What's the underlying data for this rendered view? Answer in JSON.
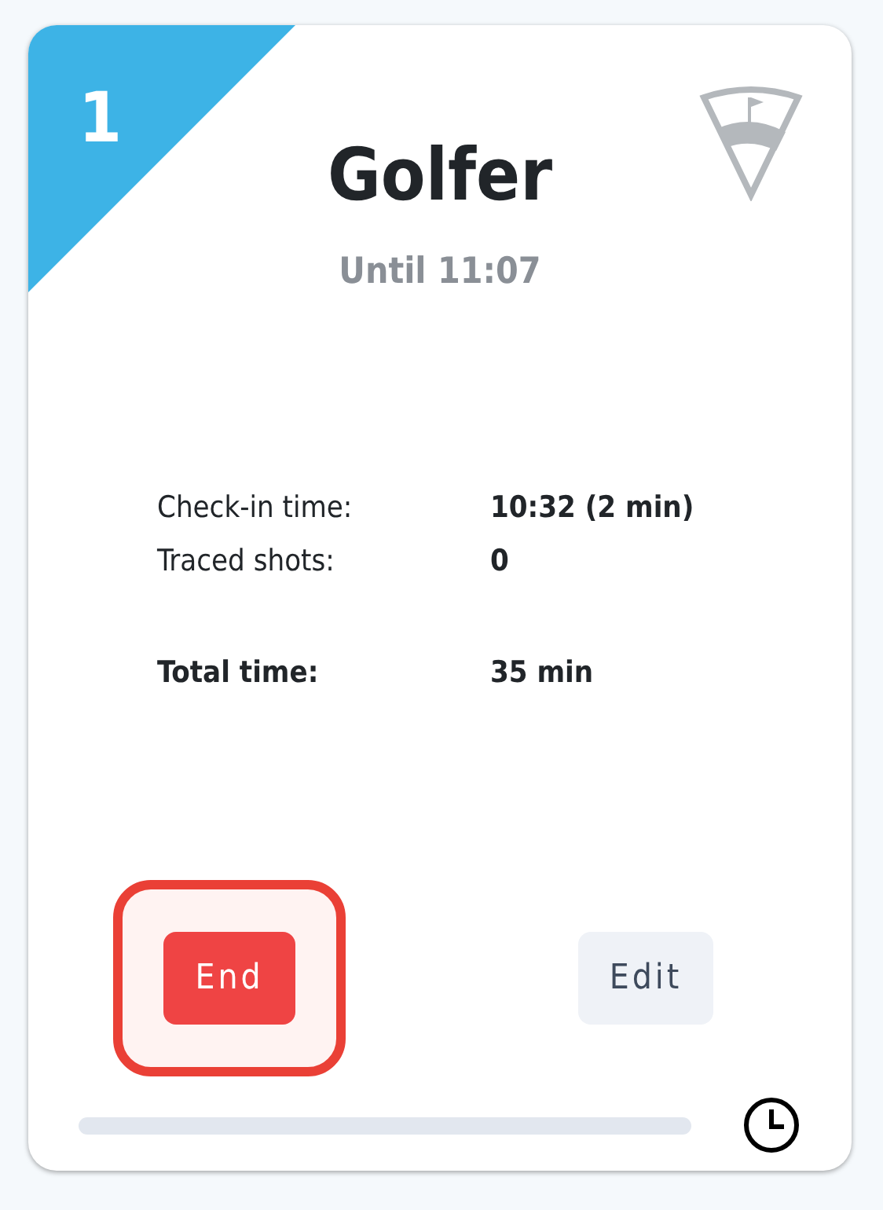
{
  "bay": {
    "number": "1",
    "color": "#3db3e6"
  },
  "title": "Golfer",
  "subtitle": "Until 11:07",
  "details": [
    {
      "label": "Check-in time:",
      "value": "10:32 (2 min)",
      "emphasis": false
    },
    {
      "label": "Traced shots:",
      "value": "0",
      "emphasis": false
    },
    {
      "label": "Total time:",
      "value": "35 min",
      "emphasis": true
    }
  ],
  "buttons": [
    {
      "label": "End",
      "kind": "danger",
      "highlighted": true
    },
    {
      "label": "Edit",
      "kind": "secondary",
      "highlighted": false
    }
  ],
  "progress": {
    "level": 0
  }
}
